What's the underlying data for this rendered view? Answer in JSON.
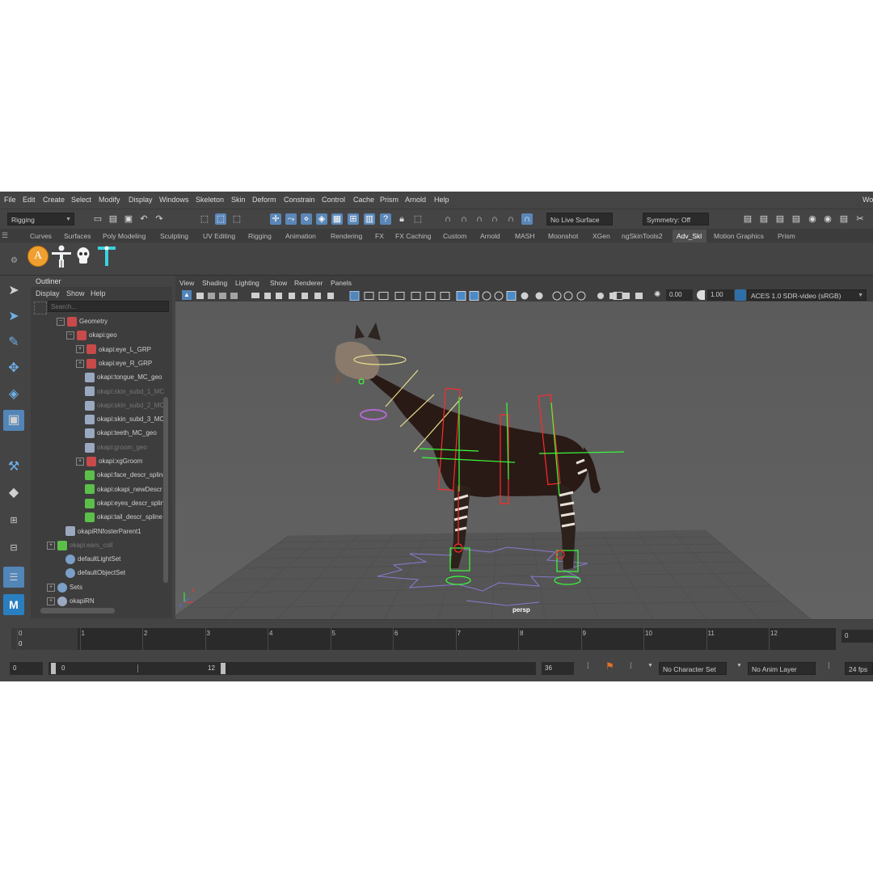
{
  "menu": [
    "File",
    "Edit",
    "Create",
    "Select",
    "Modify",
    "Display",
    "Windows",
    "Skeleton",
    "Skin",
    "Deform",
    "Constrain",
    "Control",
    "Cache",
    "Prism",
    "Arnold",
    "Help"
  ],
  "menu_right_label": "Wo",
  "status_line": {
    "menuset": "Rigging",
    "live_surface": "No Live Surface",
    "symmetry": "Symmetry: Off"
  },
  "shelf_tabs": [
    "Curves",
    "Surfaces",
    "Poly Modeling",
    "Sculpting",
    "UV Editing",
    "Rigging",
    "Animation",
    "Rendering",
    "FX",
    "FX Caching",
    "Custom",
    "Arnold",
    "MASH",
    "Moonshot",
    "XGen",
    "ngSkinTools2",
    "Adv_Skl",
    "Motion Graphics",
    "Prism"
  ],
  "active_shelf": "Adv_Skl",
  "shelf_icons": [
    "advanced-skeleton-a-icon",
    "biped-figure-icon",
    "skull-icon",
    "cyan-t-joint-icon"
  ],
  "shelf_letter": "A",
  "outliner": {
    "title": "Outliner",
    "menu": [
      "Display",
      "Show",
      "Help"
    ],
    "search_placeholder": "Search...",
    "rows": [
      {
        "label": "Geometry",
        "indent": 1,
        "icon": "mesh",
        "dim": false,
        "expand": "−"
      },
      {
        "label": "okapi:geo",
        "indent": 2,
        "icon": "mesh",
        "dim": false,
        "expand": "−"
      },
      {
        "label": "okapi:eye_L_GRP",
        "indent": 3,
        "icon": "mesh",
        "dim": false,
        "expand": "+"
      },
      {
        "label": "okapi:eye_R_GRP",
        "indent": 3,
        "icon": "mesh",
        "dim": false,
        "expand": "+"
      },
      {
        "label": "okapi:tongue_MC_geo",
        "indent": 3,
        "icon": "poly",
        "dim": false,
        "expand": ""
      },
      {
        "label": "okapi:skin_subd_1_MC",
        "indent": 3,
        "icon": "poly",
        "dim": true,
        "expand": ""
      },
      {
        "label": "okapi:skin_subd_2_MC",
        "indent": 3,
        "icon": "poly",
        "dim": true,
        "expand": ""
      },
      {
        "label": "okapi:skin_subd_3_MC",
        "indent": 3,
        "icon": "poly",
        "dim": false,
        "expand": ""
      },
      {
        "label": "okapi:teeth_MC_geo",
        "indent": 3,
        "icon": "poly",
        "dim": false,
        "expand": ""
      },
      {
        "label": "okapi:groom_geo",
        "indent": 3,
        "icon": "poly",
        "dim": true,
        "expand": ""
      },
      {
        "label": "okapi:xgGroom",
        "indent": 3,
        "icon": "mesh",
        "dim": false,
        "expand": "+"
      },
      {
        "label": "okapi:face_descr_spline",
        "indent": 3,
        "icon": "xgen",
        "dim": false,
        "expand": ""
      },
      {
        "label": "okapi:okapi_newDescr",
        "indent": 3,
        "icon": "xgen",
        "dim": false,
        "expand": ""
      },
      {
        "label": "okapi:eyes_descr_spline",
        "indent": 3,
        "icon": "xgen",
        "dim": false,
        "expand": ""
      },
      {
        "label": "okapi:tail_descr_spline",
        "indent": 3,
        "icon": "xgen",
        "dim": false,
        "expand": ""
      },
      {
        "label": "okapiRNfosterParent1",
        "indent": 1,
        "icon": "poly",
        "dim": false,
        "expand": ""
      },
      {
        "label": "okapi:ears_coll",
        "indent": 0,
        "icon": "xgen",
        "dim": true,
        "expand": "+"
      },
      {
        "label": "defaultLightSet",
        "indent": 1,
        "icon": "set",
        "dim": false,
        "expand": ""
      },
      {
        "label": "defaultObjectSet",
        "indent": 1,
        "icon": "set",
        "dim": false,
        "expand": ""
      },
      {
        "label": "Sets",
        "indent": 0,
        "icon": "set",
        "dim": false,
        "expand": "+"
      },
      {
        "label": "okapiRN",
        "indent": 0,
        "icon": "ref",
        "dim": false,
        "expand": "+"
      }
    ]
  },
  "viewport": {
    "menu": [
      "View",
      "Shading",
      "Lighting",
      "Show",
      "Renderer",
      "Panels"
    ],
    "exposure": "0.00",
    "gamma": "1.00",
    "color_space": "ACES 1.0 SDR-video (sRGB)",
    "camera_label": "persp",
    "axis_x": "x",
    "axis_z": "z"
  },
  "timeline": {
    "ticks": [
      "0",
      "1",
      "2",
      "3",
      "4",
      "5",
      "6",
      "7",
      "8",
      "9",
      "10",
      "11",
      "12"
    ],
    "current_frame_top": "0",
    "current_frame_bottom": "0",
    "right_field": "0"
  },
  "range_slider": {
    "start_field": "0",
    "range_start": "0",
    "range_end": "12",
    "end_field": "36",
    "character_set": "No Character Set",
    "anim_layer": "No Anim Layer",
    "fps": "24 fps"
  },
  "colors": {
    "accent_blue": "#5285b8",
    "rig_red": "#ff2a2a",
    "rig_green": "#39ff39",
    "rig_yellow": "#e6e08a",
    "rig_purple": "#b06ad0"
  }
}
